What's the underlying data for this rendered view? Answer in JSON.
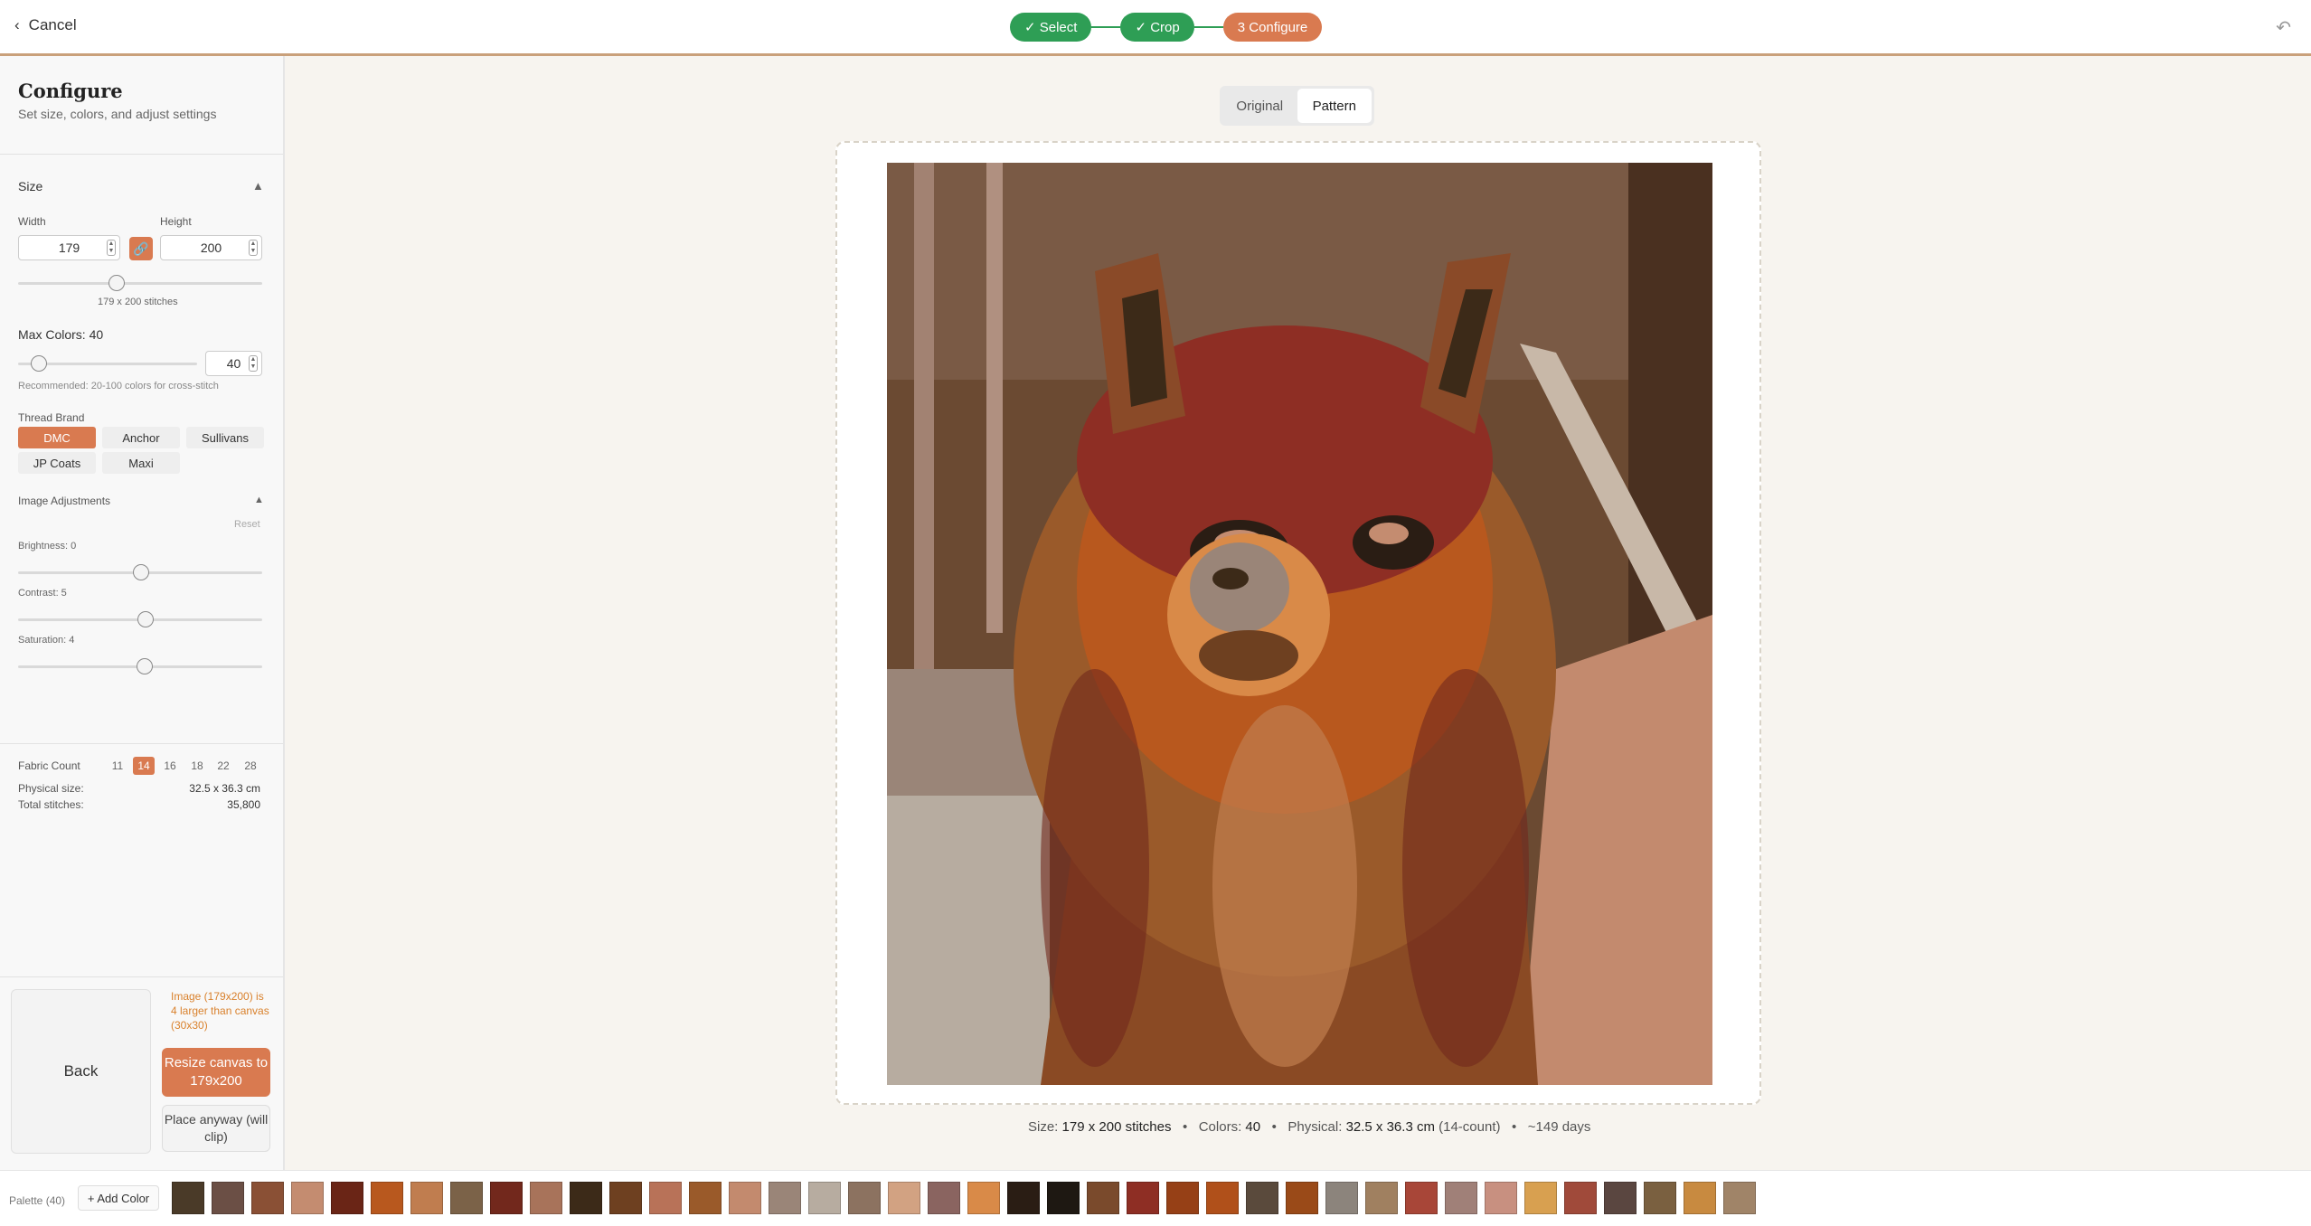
{
  "header": {
    "cancel_label": "Cancel",
    "steps": [
      {
        "label": "Select"
      },
      {
        "label": "Crop"
      },
      {
        "label": "Configure",
        "number": "3"
      }
    ]
  },
  "sidebar": {
    "title": "Configure",
    "subtitle": "Set size, colors, and adjust settings",
    "size": {
      "heading": "Size",
      "width_label": "Width",
      "height_label": "Height",
      "width": "179",
      "height": "200",
      "stitches": "179 x 200 stitches"
    },
    "colors": {
      "label": "Max Colors:",
      "value": "40",
      "box": "40",
      "hint": "Recommended: 20-100 colors for cross-stitch"
    },
    "brand": {
      "label": "Thread Brand",
      "options": [
        "DMC",
        "Anchor",
        "Sullivans",
        "JP Coats",
        "Maxi"
      ],
      "selected": "DMC"
    },
    "adjust": {
      "heading": "Image Adjustments",
      "reset": "Reset",
      "brightness": "Brightness: 0",
      "contrast": "Contrast: 5",
      "saturation": "Saturation: 4"
    },
    "fabric": {
      "label": "Fabric Count",
      "options": [
        "11",
        "14",
        "16",
        "18",
        "22",
        "28"
      ],
      "selected": "14"
    },
    "info": {
      "physical_label": "Physical size:",
      "physical_value": "32.5 x 36.3 cm",
      "total_label": "Total stitches:",
      "total_value": "35,800"
    },
    "back_label": "Back",
    "warning": "Image (179x200) is 4 larger than canvas (30x30)",
    "resize_label": "Resize canvas to 179x200",
    "place_label": "Place anyway (will clip)"
  },
  "view": {
    "original": "Original",
    "pattern": "Pattern",
    "selected": "Pattern"
  },
  "stats": {
    "size_label": "Size:",
    "size_value": "179 x 200",
    "size_unit": "stitches",
    "colors_label": "Colors:",
    "colors_value": "40",
    "physical_label": "Physical:",
    "physical_value": "32.5 x 36.3 cm",
    "physical_note": "(14-count)",
    "days": "~149 days"
  },
  "palette": {
    "label": "Palette (40)",
    "add_label": "+ Add Color",
    "colors": [
      "#4a3a28",
      "#6b4f45",
      "#8a5035",
      "#c48c70",
      "#6a2516",
      "#b8581e",
      "#c07d4f",
      "#7b6248",
      "#72281c",
      "#a8735a",
      "#3c2a18",
      "#6e4020",
      "#b87258",
      "#9a5a2a",
      "#c38a6e",
      "#9a8578",
      "#b7aca0",
      "#8c7260",
      "#d2a282",
      "#8a6460",
      "#d98a48",
      "#2a1d14",
      "#1e1812",
      "#7a4a2c",
      "#8e2e24",
      "#964016",
      "#b0501a",
      "#5a4a3c",
      "#9a4a18",
      "#8c847c",
      "#a08060",
      "#a84638",
      "#a08078",
      "#c89080",
      "#d8a050",
      "#a04a3a",
      "#5a4640",
      "#7a6040",
      "#c88a40",
      "#a08468"
    ]
  }
}
